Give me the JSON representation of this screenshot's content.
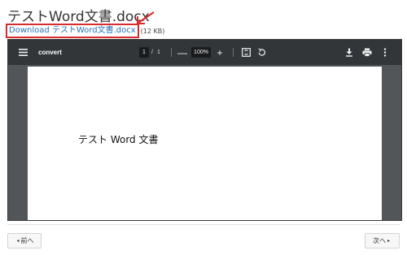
{
  "page": {
    "title": "テストWord文書.docx",
    "download_label": "Download テストWord文書.docx",
    "file_size": "(12 KB)"
  },
  "viewer": {
    "doc_name": "convert",
    "current_page": "1",
    "page_separator": "/",
    "total_pages": "1",
    "zoom_out": "—",
    "zoom": "100%",
    "zoom_in": "+",
    "icons": [
      "menu-icon",
      "fit-page-icon",
      "rotate-icon",
      "download-icon",
      "print-icon",
      "more-vert-icon"
    ],
    "colors": {
      "toolbar": "#323639",
      "background": "#525659"
    }
  },
  "document": {
    "text": "テスト Word 文書"
  },
  "navigation": {
    "prev_label": "前へ",
    "prev_arrow": "◂",
    "next_label": "次へ",
    "next_arrow": "▸"
  },
  "annotation": {
    "color": "#d92b2b"
  }
}
